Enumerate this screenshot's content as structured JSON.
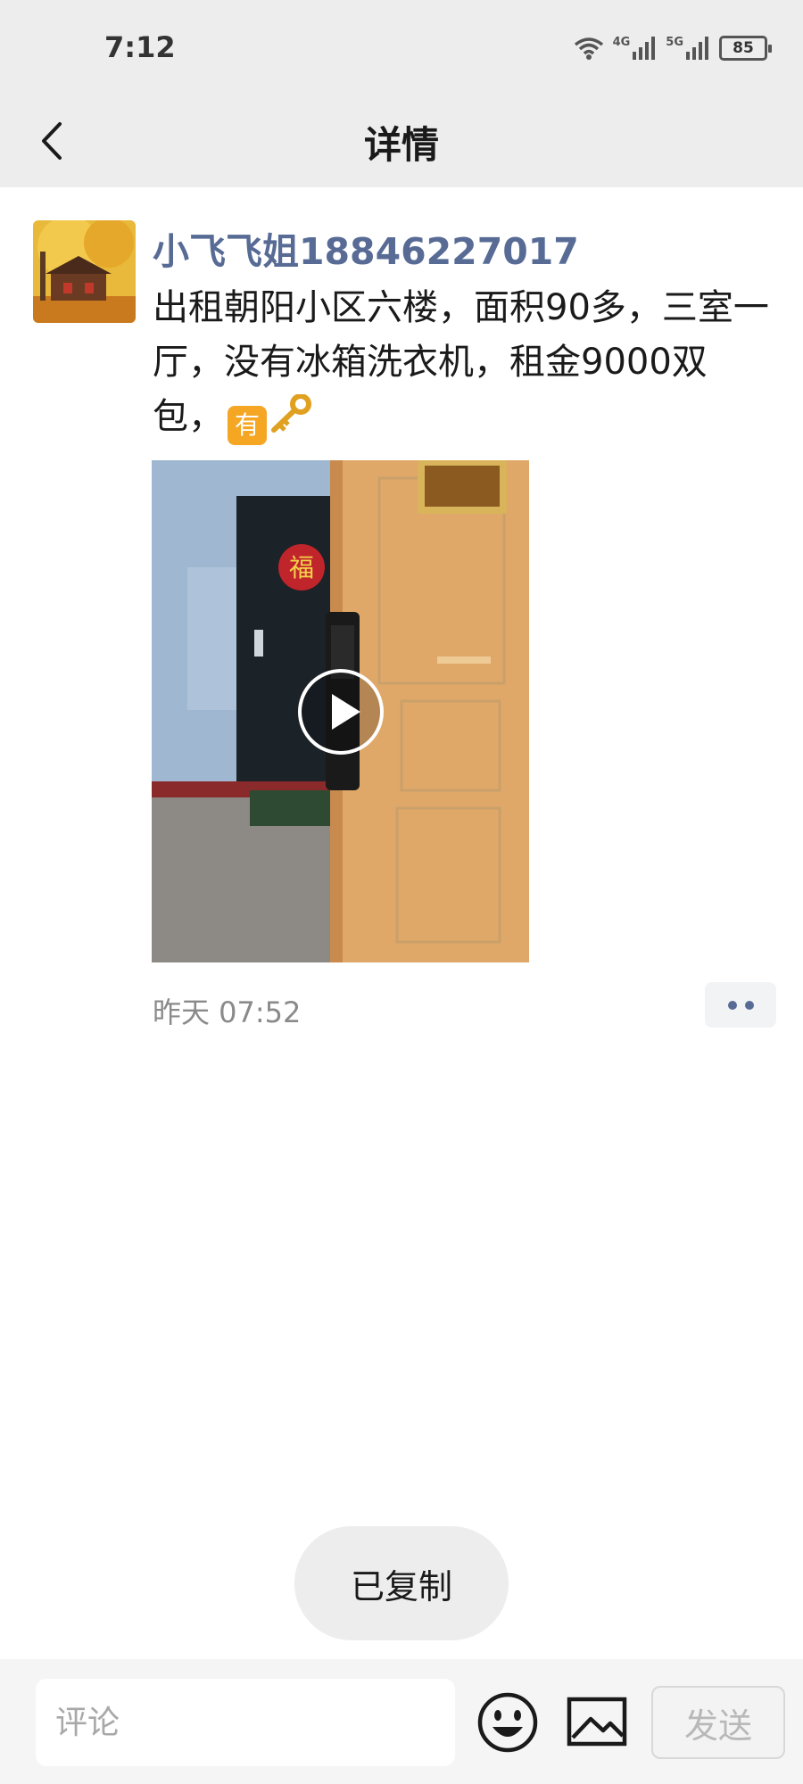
{
  "status_bar": {
    "time": "7:12",
    "network_1": "4G",
    "network_2": "5G",
    "battery": "85"
  },
  "nav": {
    "title": "详情",
    "back_icon": "chevron-left-icon"
  },
  "post": {
    "author": "小飞飞姐18846227017",
    "text": "出租朝阳小区六楼，面积90多，三室一厅，没有冰箱洗衣机，租金9000双包，",
    "emoji_badge": "有",
    "emoji_key": "key-emoji-icon",
    "video": {
      "type": "video",
      "play_icon": "play-icon"
    },
    "time": "昨天 07:52",
    "more_icon": "more-dots-icon"
  },
  "toast": {
    "text": "已复制"
  },
  "comment_bar": {
    "placeholder": "评论",
    "emoji_icon": "smiley-icon",
    "image_icon": "image-icon",
    "send_label": "发送"
  },
  "colors": {
    "header_bg": "#ededed",
    "author_name": "#576b95",
    "time_text": "#8a8a8a",
    "send_disabled": "#b8b8b8"
  }
}
